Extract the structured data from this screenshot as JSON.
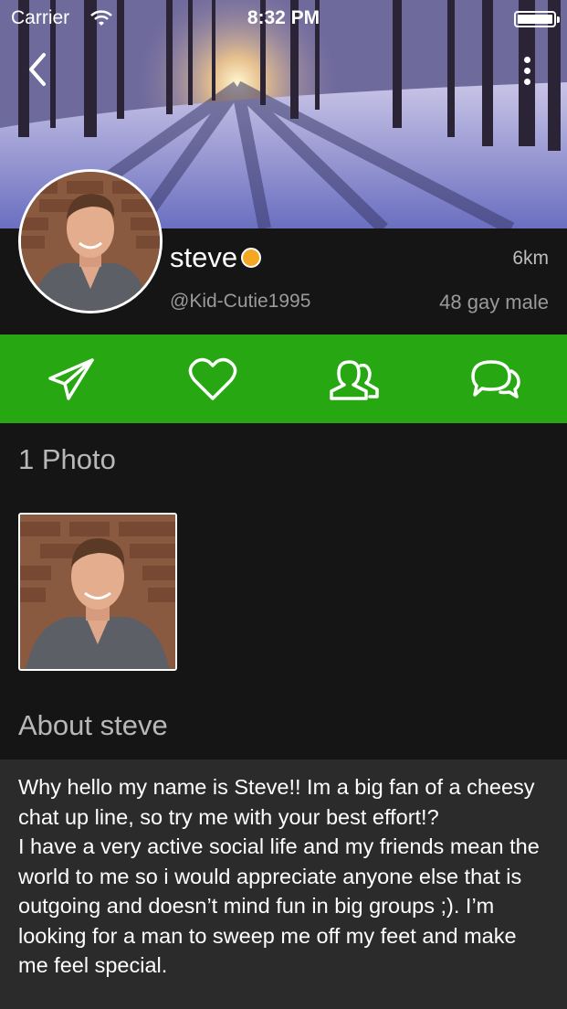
{
  "status_bar": {
    "carrier": "Carrier",
    "time": "8:32 PM",
    "icons": [
      "wifi-icon",
      "battery-icon"
    ]
  },
  "nav": {
    "back_icon": "chevron-left-icon",
    "more_icon": "more-vertical-icon"
  },
  "profile": {
    "name": "steve",
    "online_status_color": "#f5a623",
    "distance": "6km",
    "handle": "@Kid-Cutie1995",
    "demographics": "48 gay male"
  },
  "actions": [
    {
      "name": "send-message",
      "icon": "paper-plane-icon"
    },
    {
      "name": "favorite",
      "icon": "heart-icon"
    },
    {
      "name": "friends",
      "icon": "users-icon"
    },
    {
      "name": "chat",
      "icon": "chat-bubbles-icon"
    }
  ],
  "photos": {
    "title": "1 Photo"
  },
  "about": {
    "title": "About steve",
    "text": "Why hello my name is Steve!! Im a big fan of a cheesy chat up line, so try me with your best effort!?\nI have a very active social life and my friends mean the world to me so i would appreciate anyone else that is outgoing and doesn’t mind fun in big groups ;). I’m looking for a man to sweep me off my feet and make me feel special."
  },
  "colors": {
    "accent_green": "#27a812",
    "background": "#151515",
    "about_background": "#2b2b2b"
  }
}
